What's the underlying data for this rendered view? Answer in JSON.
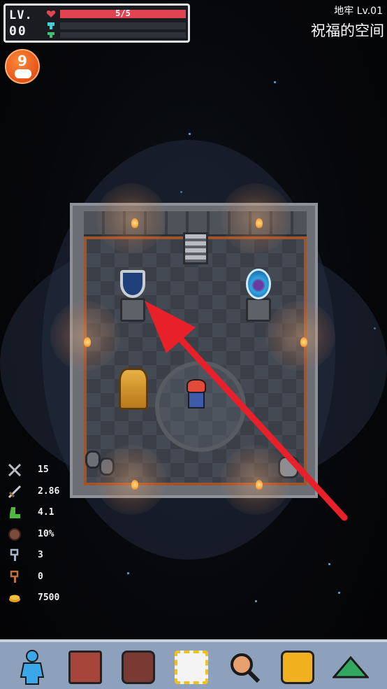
{
  "status": {
    "level_label": "LV.",
    "level_value": "00",
    "hp_text": "5/5",
    "hp_fraction": 1.0,
    "mana_fraction": 0.0,
    "xp_fraction": 0.0
  },
  "dungeon": {
    "level_text": "地牢 Lv.01",
    "room_name": "祝福的空间"
  },
  "badge": {
    "number": "9"
  },
  "stats": [
    {
      "icon": "crossed-swords-icon",
      "value": "15"
    },
    {
      "icon": "sword-icon",
      "value": "2.86"
    },
    {
      "icon": "boot-icon",
      "value": "4.1"
    },
    {
      "icon": "shield-round-icon",
      "value": "10%"
    },
    {
      "icon": "silver-key-icon",
      "value": "3"
    },
    {
      "icon": "bronze-key-icon",
      "value": "0"
    },
    {
      "icon": "gold-coins-icon",
      "value": "7500"
    }
  ],
  "toolbar": [
    {
      "icon": "character-icon"
    },
    {
      "icon": "spellbook-icon"
    },
    {
      "icon": "backpack-icon"
    },
    {
      "icon": "map-scroll-icon"
    },
    {
      "icon": "search-magnifier-icon"
    },
    {
      "icon": "pause-icon"
    },
    {
      "icon": "collapse-arrow-icon"
    }
  ],
  "colors": {
    "hp": "#e04450",
    "mana": "#40d0d8",
    "xp": "#40c070",
    "arrow": "#e8202a",
    "toolbar": "#8da0bc"
  }
}
